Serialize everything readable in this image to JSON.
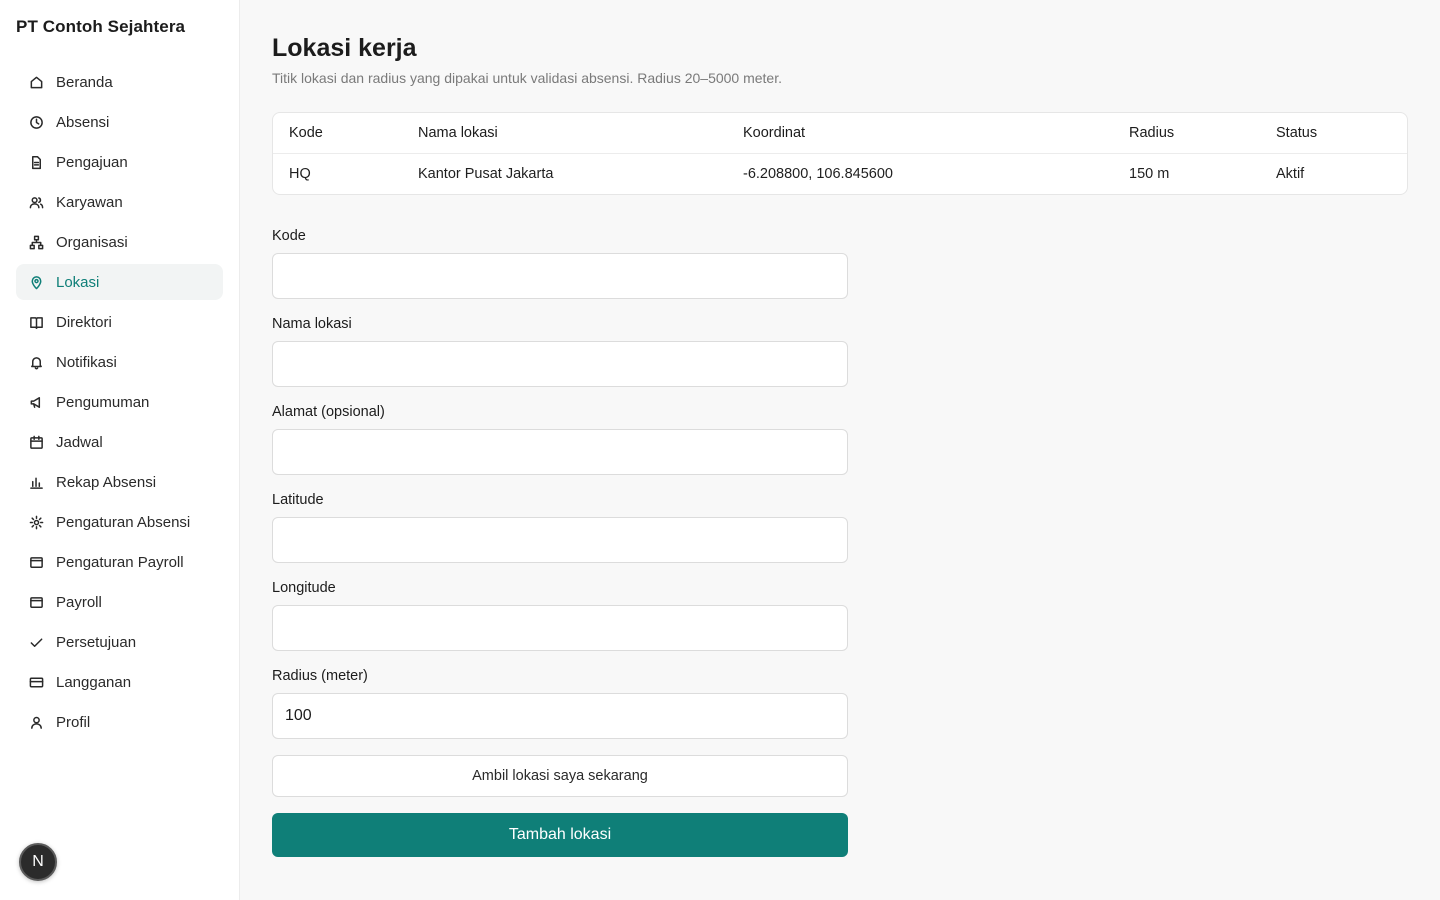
{
  "app": {
    "company_name": "PT Contoh Sejahtera",
    "avatar_letter": "N",
    "accent_color": "#0f7f78"
  },
  "sidebar": {
    "items": [
      {
        "label": "Beranda",
        "icon": "home-icon"
      },
      {
        "label": "Absensi",
        "icon": "clock-icon"
      },
      {
        "label": "Pengajuan",
        "icon": "file-icon"
      },
      {
        "label": "Karyawan",
        "icon": "users-icon"
      },
      {
        "label": "Organisasi",
        "icon": "org-chart-icon"
      },
      {
        "label": "Lokasi",
        "icon": "map-pin-icon",
        "active": true
      },
      {
        "label": "Direktori",
        "icon": "book-icon"
      },
      {
        "label": "Notifikasi",
        "icon": "bell-icon"
      },
      {
        "label": "Pengumuman",
        "icon": "megaphone-icon"
      },
      {
        "label": "Jadwal",
        "icon": "calendar-icon"
      },
      {
        "label": "Rekap Absensi",
        "icon": "bar-chart-icon"
      },
      {
        "label": "Pengaturan Absensi",
        "icon": "gear-icon"
      },
      {
        "label": "Pengaturan Payroll",
        "icon": "wallet-icon"
      },
      {
        "label": "Payroll",
        "icon": "wallet-icon"
      },
      {
        "label": "Persetujuan",
        "icon": "check-icon"
      },
      {
        "label": "Langganan",
        "icon": "credit-card-icon"
      },
      {
        "label": "Profil",
        "icon": "user-icon"
      }
    ]
  },
  "page": {
    "title": "Lokasi kerja",
    "subtitle": "Titik lokasi dan radius yang dipakai untuk validasi absensi. Radius 20–5000 meter."
  },
  "table": {
    "headers": [
      "Kode",
      "Nama lokasi",
      "Koordinat",
      "Radius",
      "Status"
    ],
    "rows": [
      [
        "HQ",
        "Kantor Pusat Jakarta",
        "-6.208800, 106.845600",
        "150 m",
        "Aktif"
      ]
    ]
  },
  "form": {
    "kode": {
      "label": "Kode",
      "value": ""
    },
    "nama": {
      "label": "Nama lokasi",
      "value": ""
    },
    "alamat": {
      "label": "Alamat (opsional)",
      "value": ""
    },
    "latitude": {
      "label": "Latitude",
      "value": ""
    },
    "longitude": {
      "label": "Longitude",
      "value": ""
    },
    "radius": {
      "label": "Radius (meter)",
      "value": "100"
    },
    "locate_button": "Ambil lokasi saya sekarang",
    "submit_button": "Tambah lokasi"
  }
}
